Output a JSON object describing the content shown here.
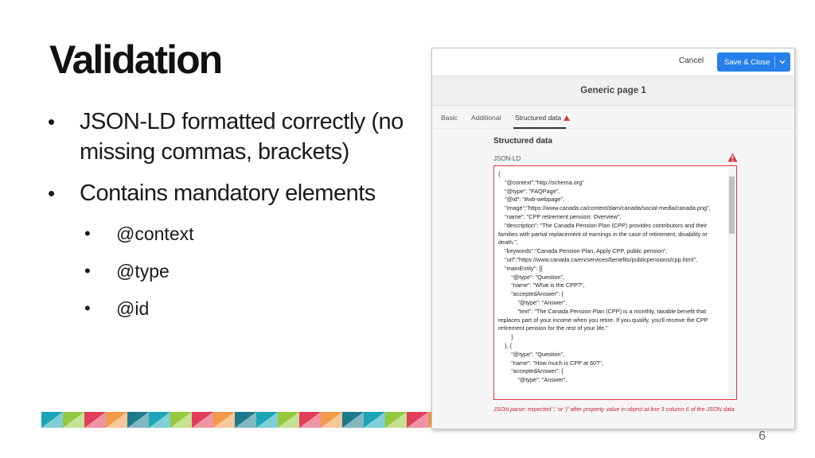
{
  "slide": {
    "title": "Validation",
    "bullets": [
      "JSON-LD formatted correctly (no missing commas, brackets)",
      "Contains mandatory elements"
    ],
    "sub_bullets": [
      "@context",
      "@type",
      "@id"
    ],
    "page_number": "6"
  },
  "stripe_colors": [
    "#1aa6b7",
    "#95c93d",
    "#e23d5b",
    "#f2994a",
    "#1c7a8c"
  ],
  "editor": {
    "cancel_label": "Cancel",
    "save_label": "Save & Close",
    "page_title": "Generic page 1",
    "tabs": [
      {
        "label": "Basic"
      },
      {
        "label": "Additional"
      },
      {
        "label": "Structured data"
      }
    ],
    "section_title": "Structured data",
    "field_label": "JSON-LD",
    "json_value": "{\n    \"@context\":\"http://schema.org\"\n    \"@type\": \"FAQPage\",\n    \"@id\": \"#wb-webpage\",\n    \"image\":\"https://www.canada.ca/content/dam/canada/social-media/canada.png\",\n    \"name\": \"CPP retirement pension: Overview\",\n    \"description\": \"The Canada Pension Plan (CPP) provides contributors and their families with partial replacement of earnings in the case of retirement, disability or death.\",\n    \"keywords\":\"Canada Pension Plan, Apply CPP, public pension\",\n    \"url\":\"https://www.canada.ca/en/services/benefits/publicpensions/cpp.html\",\n    \"mainEntity\": [{\n        \"@type\": \"Question\",\n        \"name\": \"What is the CPP?\",\n        \"acceptedAnswer\": {\n            \"@type\": \"Answer\",\n            \"text\": \"The Canada Pension Plan (CPP) is a monthly, taxable benefit that replaces part of your income when you retire. If you qualify, you'll receive the CPP retirement pension for the rest of your life.\"\n        }\n    }, {\n        \"@type\": \"Question\",\n        \"name\": \"How much is CPP at 60?\",\n        \"acceptedAnswer\": {\n            \"@type\": \"Answer\",",
    "error_message": "JSON.parse: expected ',' or '}' after property value in object at line 3 column 6 of the JSON data",
    "accent_color": "#2680eb",
    "error_color": "#d7373f"
  }
}
